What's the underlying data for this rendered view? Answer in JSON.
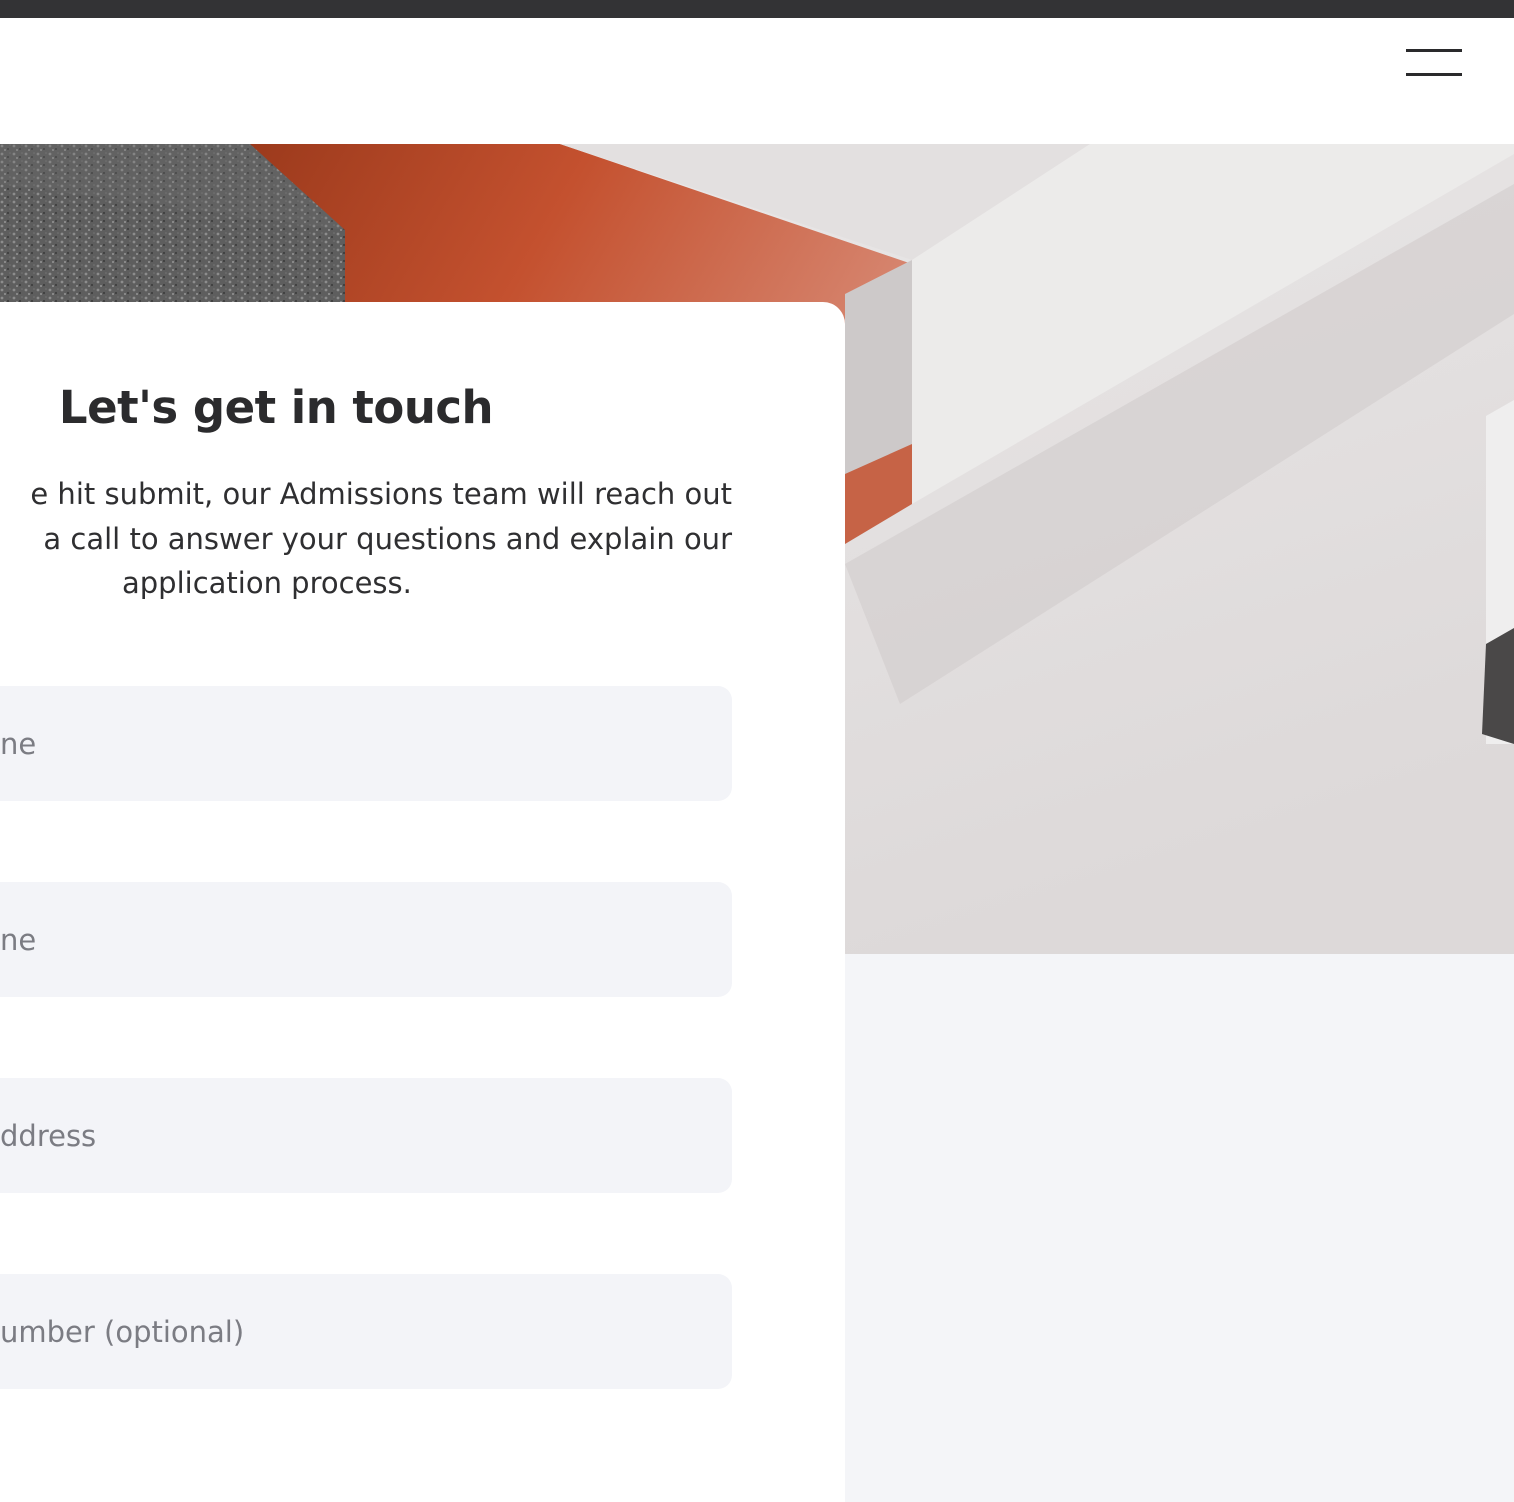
{
  "header": {
    "menu_icon": "hamburger-menu-icon"
  },
  "hero": {
    "image": "abstract-3d-blocks-image"
  },
  "form": {
    "title": "Let's get in touch",
    "intro_line1": "e hit submit, our Admissions team will reach out",
    "intro_line2": "a call to answer your questions and explain our",
    "intro_line3": "application process.",
    "fields": [
      {
        "placeholder": "ne",
        "value": ""
      },
      {
        "placeholder": "ne",
        "value": ""
      },
      {
        "placeholder": "ddress",
        "value": ""
      },
      {
        "placeholder": "umber (optional)",
        "value": ""
      }
    ]
  },
  "colors": {
    "accent_orange": "#c4512f",
    "field_bg": "#f3f4f8",
    "text_dark": "#2b2b2d",
    "placeholder": "#7b7c83"
  }
}
